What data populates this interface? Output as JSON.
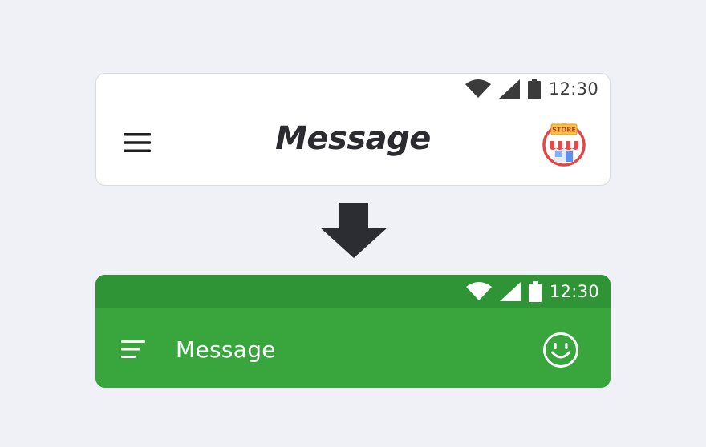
{
  "before": {
    "status_time": "12:30",
    "title": "Message",
    "icons": {
      "menu": "hamburger-menu-icon",
      "action": "store-icon",
      "store_sign": "STORE"
    },
    "colors": {
      "background": "#ffffff",
      "title": "#2b2b30",
      "status": "#3b3b3b"
    }
  },
  "transition": {
    "icon": "down-arrow-icon"
  },
  "after": {
    "status_time": "12:30",
    "title": "Message",
    "icons": {
      "menu": "sort-lines-menu-icon",
      "action": "smiley-face-icon"
    },
    "colors": {
      "background": "#38a53d",
      "status_bar": "#2f9435",
      "foreground": "#ffffff"
    }
  }
}
